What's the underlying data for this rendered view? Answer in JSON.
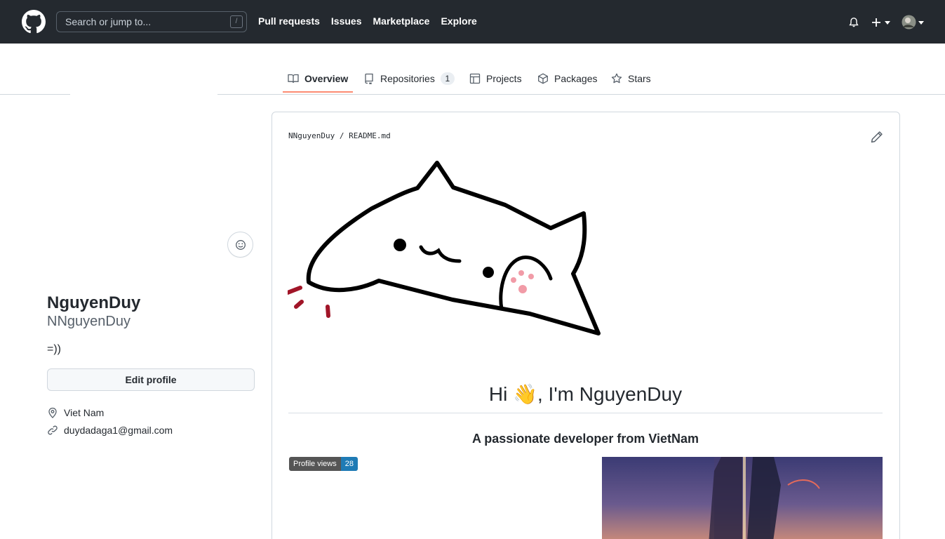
{
  "header": {
    "search_placeholder": "Search or jump to...",
    "search_shortcut": "/",
    "nav": [
      "Pull requests",
      "Issues",
      "Marketplace",
      "Explore"
    ],
    "colors": {
      "background": "#24292f",
      "text": "#ffffff"
    }
  },
  "tabs": [
    {
      "label": "Overview",
      "icon": "book-icon",
      "active": true
    },
    {
      "label": "Repositories",
      "icon": "repo-icon",
      "count": "1"
    },
    {
      "label": "Projects",
      "icon": "table-icon"
    },
    {
      "label": "Packages",
      "icon": "package-icon"
    },
    {
      "label": "Stars",
      "icon": "star-icon"
    }
  ],
  "profile": {
    "name": "NguyenDuy",
    "login": "NNguyenDuy",
    "bio": "=))",
    "edit_label": "Edit profile",
    "location": "Viet Nam",
    "email": "duydadaga1@gmail.com"
  },
  "readme": {
    "crumb_user": "NNguyenDuy",
    "crumb_sep": " / ",
    "crumb_file": "README.md",
    "heading": "Hi 👋, I'm NguyenDuy",
    "subheading": "A passionate developer from VietNam",
    "badge_label": "Profile views",
    "badge_value": "28",
    "accent_color": "#fd8c73"
  }
}
